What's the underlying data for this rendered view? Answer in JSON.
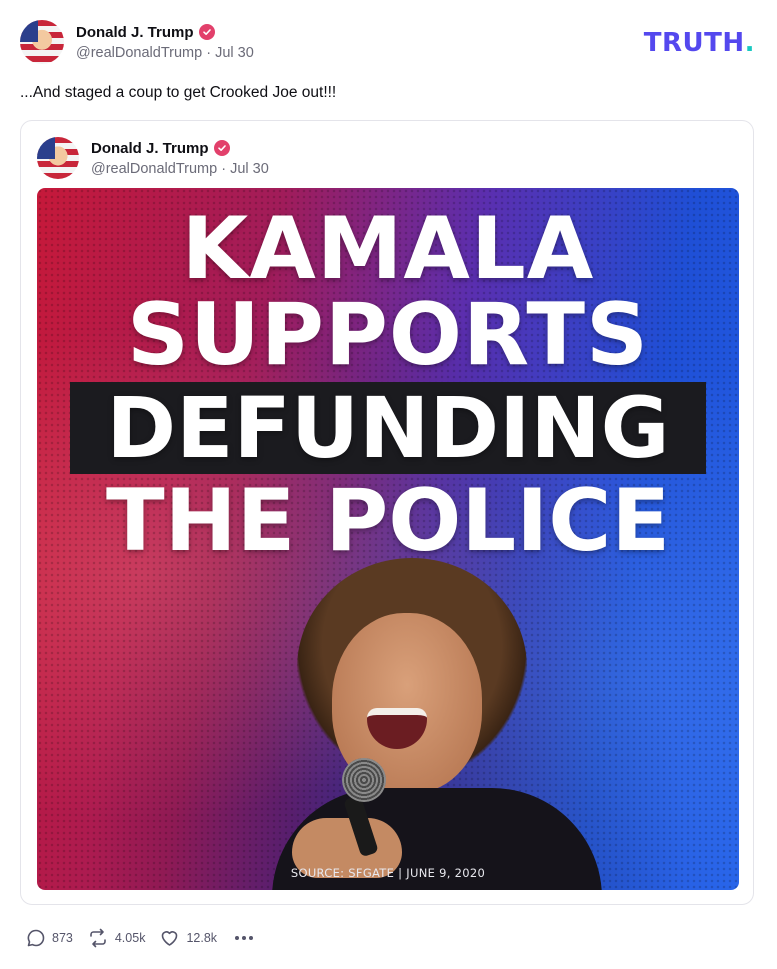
{
  "post": {
    "author_name": "Donald J. Trump",
    "handle": "@realDonaldTrump",
    "separator": "·",
    "date": "Jul 30",
    "text": "...And staged a coup to get Crooked Joe out!!!"
  },
  "brand": {
    "logo_text": "TRUTH",
    "logo_dot": ".",
    "logo_color": "#5448ee",
    "dot_color": "#18c9c1"
  },
  "quoted_post": {
    "author_name": "Donald J. Trump",
    "handle": "@realDonaldTrump",
    "separator": "·",
    "date": "Jul 30",
    "image": {
      "line1": "KAMALA",
      "line2": "SUPPORTS",
      "line3": "DEFUNDING",
      "line4": "THE POLICE",
      "source": "SOURCE: SFGATE | JUNE 9, 2020"
    }
  },
  "actions": {
    "replies": "873",
    "retruths": "4.05k",
    "likes": "12.8k"
  },
  "icons": {
    "verified": "verified-badge-icon",
    "reply": "comment-bubble-icon",
    "retruth": "repost-arrows-icon",
    "like": "heart-icon",
    "more": "more-dots-icon"
  },
  "colors": {
    "verified": "#e2406b",
    "muted_text": "#6b6b78"
  }
}
